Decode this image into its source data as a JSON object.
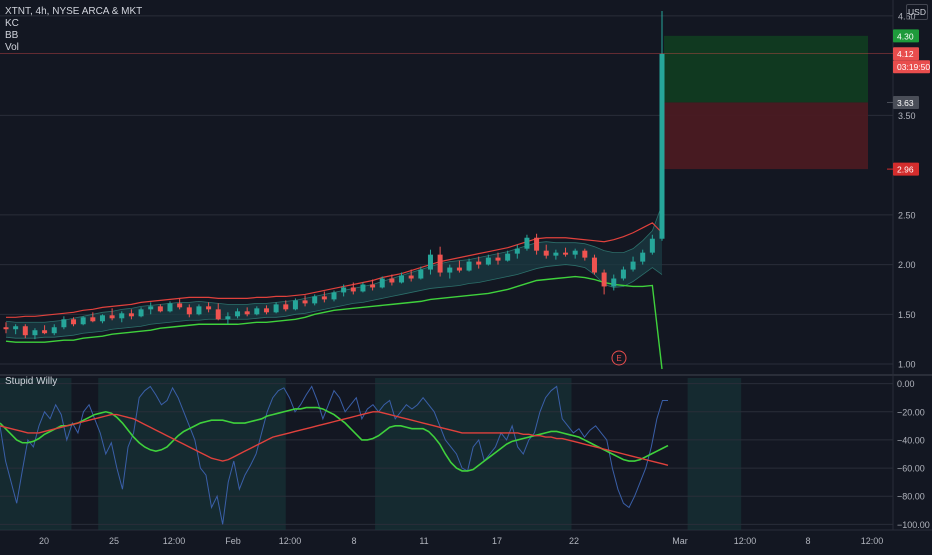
{
  "header": {
    "symbol_line": "XTNT, 4h, NYSE ARCA & MKT",
    "indicators": [
      "KC",
      "BB",
      "Vol"
    ],
    "currency": "USD"
  },
  "sub_indicator": {
    "title": "Stupid Willy"
  },
  "colors": {
    "background": "#131722",
    "up": "#26a69a",
    "down": "#ef5350",
    "keltner_upper": "#e0413c",
    "keltner_lower": "#3fd13c",
    "bb_fill": "#1b3b43",
    "profit_zone": "#103b21",
    "loss_zone": "#4a1a22",
    "willy_line": "#3a5fa8",
    "fast_ma": "#3fd13c",
    "slow_ma": "#e0413c"
  },
  "chart_data": [
    {
      "type": "candlestick",
      "title": "XTNT, 4h, NYSE ARCA & MKT",
      "ylim": [
        0.92,
        4.62
      ],
      "y_ticks": [
        1.0,
        1.5,
        2.0,
        2.5,
        3.5,
        4.5
      ],
      "x_ticks": [
        "20",
        "25",
        "12:00",
        "Feb",
        "12:00",
        "8",
        "11",
        "17",
        "22",
        "Mar",
        "12:00",
        "8",
        "12:00"
      ],
      "price_labels": [
        {
          "label": "4.30",
          "value": 4.3,
          "kind": "take-profit"
        },
        {
          "label": "4.12",
          "value": 4.12,
          "kind": "last-price"
        },
        {
          "label": "03:19:50",
          "value": 4.0,
          "kind": "countdown"
        },
        {
          "label": "3.63",
          "value": 3.63,
          "kind": "entry"
        },
        {
          "label": "2.96",
          "value": 2.96,
          "kind": "stop-loss"
        }
      ],
      "candles_ohlc": [
        [
          1.37,
          1.42,
          1.31,
          1.35
        ],
        [
          1.35,
          1.4,
          1.3,
          1.38
        ],
        [
          1.38,
          1.4,
          1.26,
          1.29
        ],
        [
          1.29,
          1.36,
          1.25,
          1.34
        ],
        [
          1.34,
          1.39,
          1.3,
          1.31
        ],
        [
          1.31,
          1.4,
          1.29,
          1.37
        ],
        [
          1.37,
          1.48,
          1.35,
          1.45
        ],
        [
          1.45,
          1.47,
          1.38,
          1.4
        ],
        [
          1.4,
          1.48,
          1.39,
          1.47
        ],
        [
          1.47,
          1.52,
          1.42,
          1.43
        ],
        [
          1.43,
          1.5,
          1.41,
          1.49
        ],
        [
          1.49,
          1.56,
          1.44,
          1.46
        ],
        [
          1.46,
          1.53,
          1.42,
          1.51
        ],
        [
          1.51,
          1.55,
          1.45,
          1.48
        ],
        [
          1.48,
          1.57,
          1.47,
          1.55
        ],
        [
          1.55,
          1.62,
          1.5,
          1.58
        ],
        [
          1.58,
          1.6,
          1.52,
          1.53
        ],
        [
          1.53,
          1.63,
          1.52,
          1.61
        ],
        [
          1.61,
          1.66,
          1.55,
          1.57
        ],
        [
          1.57,
          1.6,
          1.47,
          1.5
        ],
        [
          1.5,
          1.6,
          1.49,
          1.58
        ],
        [
          1.58,
          1.62,
          1.52,
          1.55
        ],
        [
          1.55,
          1.61,
          1.44,
          1.45
        ],
        [
          1.45,
          1.52,
          1.4,
          1.48
        ],
        [
          1.48,
          1.56,
          1.46,
          1.53
        ],
        [
          1.53,
          1.57,
          1.48,
          1.5
        ],
        [
          1.5,
          1.58,
          1.49,
          1.56
        ],
        [
          1.56,
          1.59,
          1.5,
          1.52
        ],
        [
          1.52,
          1.62,
          1.51,
          1.6
        ],
        [
          1.6,
          1.64,
          1.53,
          1.55
        ],
        [
          1.55,
          1.66,
          1.54,
          1.64
        ],
        [
          1.64,
          1.69,
          1.58,
          1.61
        ],
        [
          1.61,
          1.7,
          1.59,
          1.68
        ],
        [
          1.68,
          1.73,
          1.62,
          1.65
        ],
        [
          1.65,
          1.74,
          1.63,
          1.72
        ],
        [
          1.72,
          1.8,
          1.68,
          1.77
        ],
        [
          1.77,
          1.82,
          1.7,
          1.73
        ],
        [
          1.73,
          1.82,
          1.72,
          1.8
        ],
        [
          1.8,
          1.85,
          1.74,
          1.77
        ],
        [
          1.77,
          1.88,
          1.76,
          1.86
        ],
        [
          1.86,
          1.9,
          1.79,
          1.82
        ],
        [
          1.82,
          1.92,
          1.81,
          1.89
        ],
        [
          1.89,
          1.95,
          1.83,
          1.86
        ],
        [
          1.86,
          1.98,
          1.85,
          1.95
        ],
        [
          1.95,
          2.15,
          1.9,
          2.1
        ],
        [
          2.1,
          2.18,
          1.88,
          1.92
        ],
        [
          1.92,
          2.0,
          1.86,
          1.97
        ],
        [
          1.97,
          2.04,
          1.92,
          1.94
        ],
        [
          1.94,
          2.06,
          1.93,
          2.03
        ],
        [
          2.03,
          2.08,
          1.96,
          2.0
        ],
        [
          2.0,
          2.1,
          1.99,
          2.07
        ],
        [
          2.07,
          2.12,
          2.0,
          2.04
        ],
        [
          2.04,
          2.14,
          2.03,
          2.11
        ],
        [
          2.11,
          2.2,
          2.06,
          2.16
        ],
        [
          2.16,
          2.3,
          2.14,
          2.27
        ],
        [
          2.27,
          2.31,
          2.1,
          2.14
        ],
        [
          2.14,
          2.2,
          2.06,
          2.09
        ],
        [
          2.09,
          2.15,
          2.05,
          2.12
        ],
        [
          2.12,
          2.17,
          2.08,
          2.1
        ],
        [
          2.1,
          2.16,
          2.06,
          2.14
        ],
        [
          2.14,
          2.16,
          2.04,
          2.07
        ],
        [
          2.07,
          2.1,
          1.9,
          1.92
        ],
        [
          1.92,
          1.95,
          1.7,
          1.78
        ],
        [
          1.78,
          1.9,
          1.74,
          1.86
        ],
        [
          1.86,
          1.98,
          1.84,
          1.95
        ],
        [
          1.95,
          2.08,
          1.93,
          2.03
        ],
        [
          2.03,
          2.15,
          2.0,
          2.12
        ],
        [
          2.12,
          2.3,
          2.1,
          2.26
        ],
        [
          2.26,
          4.55,
          2.24,
          4.12
        ]
      ],
      "keltner_upper": [
        1.47,
        1.47,
        1.48,
        1.48,
        1.49,
        1.5,
        1.51,
        1.52,
        1.54,
        1.55,
        1.57,
        1.58,
        1.59,
        1.6,
        1.62,
        1.63,
        1.64,
        1.65,
        1.66,
        1.67,
        1.67,
        1.67,
        1.66,
        1.66,
        1.66,
        1.66,
        1.67,
        1.67,
        1.68,
        1.68,
        1.69,
        1.7,
        1.72,
        1.74,
        1.76,
        1.78,
        1.8,
        1.82,
        1.84,
        1.87,
        1.89,
        1.91,
        1.94,
        1.97,
        2.0,
        2.03,
        2.05,
        2.07,
        2.09,
        2.11,
        2.13,
        2.15,
        2.17,
        2.2,
        2.23,
        2.26,
        2.27,
        2.27,
        2.27,
        2.26,
        2.25,
        2.24,
        2.23,
        2.25,
        2.28,
        2.32,
        2.37,
        2.42,
        2.32
      ],
      "keltner_lower": [
        1.23,
        1.22,
        1.22,
        1.22,
        1.22,
        1.23,
        1.24,
        1.24,
        1.26,
        1.27,
        1.28,
        1.3,
        1.31,
        1.32,
        1.33,
        1.34,
        1.36,
        1.37,
        1.38,
        1.39,
        1.4,
        1.4,
        1.4,
        1.4,
        1.4,
        1.41,
        1.42,
        1.42,
        1.43,
        1.44,
        1.45,
        1.47,
        1.5,
        1.52,
        1.54,
        1.55,
        1.56,
        1.57,
        1.58,
        1.59,
        1.6,
        1.61,
        1.62,
        1.63,
        1.65,
        1.66,
        1.67,
        1.68,
        1.69,
        1.7,
        1.71,
        1.73,
        1.75,
        1.78,
        1.81,
        1.84,
        1.85,
        1.86,
        1.87,
        1.88,
        1.87,
        1.85,
        1.82,
        1.8,
        1.79,
        1.78,
        1.78,
        1.79,
        0.95
      ],
      "bb_upper": [
        1.43,
        1.42,
        1.42,
        1.42,
        1.42,
        1.43,
        1.44,
        1.46,
        1.48,
        1.5,
        1.52,
        1.53,
        1.55,
        1.56,
        1.58,
        1.59,
        1.6,
        1.61,
        1.62,
        1.62,
        1.63,
        1.62,
        1.61,
        1.6,
        1.6,
        1.6,
        1.61,
        1.61,
        1.62,
        1.63,
        1.64,
        1.66,
        1.68,
        1.7,
        1.72,
        1.74,
        1.76,
        1.78,
        1.8,
        1.83,
        1.86,
        1.89,
        1.92,
        1.95,
        1.98,
        2.01,
        2.03,
        2.04,
        2.05,
        2.07,
        2.09,
        2.11,
        2.13,
        2.16,
        2.19,
        2.22,
        2.23,
        2.22,
        2.22,
        2.22,
        2.21,
        2.18,
        2.14,
        2.12,
        2.12,
        2.16,
        2.24,
        2.34,
        2.6
      ],
      "bb_lower": [
        1.27,
        1.26,
        1.26,
        1.26,
        1.27,
        1.27,
        1.28,
        1.29,
        1.31,
        1.32,
        1.33,
        1.35,
        1.36,
        1.37,
        1.38,
        1.4,
        1.41,
        1.42,
        1.43,
        1.44,
        1.44,
        1.45,
        1.45,
        1.45,
        1.45,
        1.45,
        1.46,
        1.47,
        1.47,
        1.48,
        1.5,
        1.51,
        1.53,
        1.55,
        1.57,
        1.59,
        1.61,
        1.62,
        1.64,
        1.66,
        1.68,
        1.7,
        1.72,
        1.74,
        1.76,
        1.77,
        1.78,
        1.79,
        1.81,
        1.82,
        1.84,
        1.86,
        1.88,
        1.9,
        1.93,
        1.96,
        1.98,
        1.99,
        2.0,
        1.99,
        1.97,
        1.9,
        1.8,
        1.77,
        1.78,
        1.83,
        1.9,
        1.97,
        1.9
      ],
      "profit_zone": [
        3.63,
        4.3
      ],
      "loss_zone": [
        2.96,
        3.63
      ],
      "annotations": [
        "E"
      ]
    },
    {
      "type": "line",
      "title": "Stupid Willy",
      "ylim": [
        -104,
        4
      ],
      "y_ticks": [
        0,
        -20,
        -40,
        -60,
        -80,
        -100
      ],
      "y_tick_labels": [
        "0.00",
        "−20.00",
        "−40.00",
        "−60.00",
        "−80.00",
        "−100.00"
      ],
      "series": [
        {
          "values": [
            -30,
            -55,
            -70,
            -85,
            -62,
            -40,
            -45,
            -30,
            -20,
            -25,
            -15,
            -22,
            -40,
            -28,
            -35,
            -20,
            -15,
            -25,
            -35,
            -50,
            -42,
            -60,
            -75,
            -45,
            -35,
            -10,
            -5,
            -2,
            -8,
            -15,
            -12,
            -3,
            -10,
            -20,
            -30,
            -40,
            -60,
            -65,
            -88,
            -80,
            -100,
            -70,
            -55,
            -75,
            -65,
            -58,
            -50,
            -35,
            -20,
            -10,
            -5,
            -3,
            -10,
            -20,
            -15,
            -8,
            -2,
            -12,
            -25,
            -15,
            -5,
            -10,
            -20,
            -15,
            -10,
            -25,
            -18,
            -15,
            -20,
            -15,
            -12,
            -25,
            -20,
            -15,
            -18,
            -15,
            -10,
            -15,
            -20,
            -30,
            -40,
            -45,
            -50,
            -60,
            -62,
            -45,
            -40,
            -55,
            -50,
            -45,
            -35,
            -40,
            -30,
            -45,
            -50,
            -40,
            -35,
            -20,
            -10,
            -5,
            -2,
            -25,
            -30,
            -35,
            -32,
            -38,
            -33,
            -30,
            -35,
            -40,
            -60,
            -75,
            -85,
            -88,
            -80,
            -70,
            -60,
            -45,
            -25,
            -12,
            -12
          ]
        },
        {
          "values": [
            -28,
            -32,
            -36,
            -40,
            -42,
            -42,
            -41,
            -39,
            -36,
            -34,
            -32,
            -30,
            -30,
            -29,
            -28,
            -26,
            -24,
            -22,
            -21,
            -20,
            -21,
            -24,
            -28,
            -33,
            -38,
            -42,
            -45,
            -47,
            -48,
            -47,
            -45,
            -41,
            -37,
            -34,
            -32,
            -30,
            -28,
            -27,
            -26,
            -26,
            -26,
            -27,
            -28,
            -28,
            -28,
            -27,
            -26,
            -25,
            -23,
            -22,
            -21,
            -20,
            -19,
            -18,
            -18,
            -17,
            -17,
            -17,
            -18,
            -20,
            -22,
            -25,
            -28,
            -32,
            -36,
            -40,
            -40,
            -39,
            -37,
            -34,
            -31,
            -30,
            -30,
            -31,
            -32,
            -32,
            -32,
            -34,
            -38,
            -43,
            -50,
            -56,
            -60,
            -62,
            -62,
            -61,
            -58,
            -55,
            -52,
            -49,
            -46,
            -43,
            -41,
            -40,
            -39,
            -38,
            -37,
            -36,
            -35,
            -34,
            -34,
            -35,
            -36,
            -37,
            -38,
            -40,
            -42,
            -44,
            -46,
            -48,
            -50,
            -52,
            -54,
            -55,
            -55,
            -54,
            -52,
            -50,
            -48,
            -46,
            -44
          ]
        },
        {
          "values": [
            -30,
            -31,
            -32,
            -33,
            -34,
            -35,
            -35,
            -35,
            -34,
            -33,
            -32,
            -31,
            -30,
            -29,
            -28,
            -27,
            -26,
            -25,
            -24,
            -23,
            -22,
            -22,
            -23,
            -24,
            -25,
            -27,
            -29,
            -31,
            -33,
            -35,
            -37,
            -39,
            -41,
            -43,
            -45,
            -47,
            -49,
            -51,
            -53,
            -54,
            -55,
            -54,
            -52,
            -50,
            -48,
            -46,
            -44,
            -42,
            -40,
            -38,
            -37,
            -36,
            -35,
            -34,
            -33,
            -32,
            -31,
            -30,
            -29,
            -28,
            -27,
            -26,
            -25,
            -24,
            -23,
            -22,
            -21,
            -20,
            -20,
            -21,
            -22,
            -23,
            -24,
            -25,
            -26,
            -27,
            -28,
            -29,
            -30,
            -31,
            -32,
            -33,
            -34,
            -35,
            -35,
            -35,
            -35,
            -35,
            -35,
            -35,
            -35,
            -35,
            -35,
            -35,
            -36,
            -36,
            -37,
            -37,
            -38,
            -38,
            -39,
            -39,
            -40,
            -41,
            -42,
            -43,
            -44,
            -45,
            -46,
            -47,
            -48,
            -49,
            -50,
            -51,
            -52,
            -53,
            -54,
            -55,
            -56,
            -57,
            -58
          ]
        }
      ],
      "shaded_ranges": [
        [
          0.0,
          0.08
        ],
        [
          0.11,
          0.32
        ],
        [
          0.42,
          0.64
        ],
        [
          0.77,
          0.83
        ]
      ]
    }
  ]
}
